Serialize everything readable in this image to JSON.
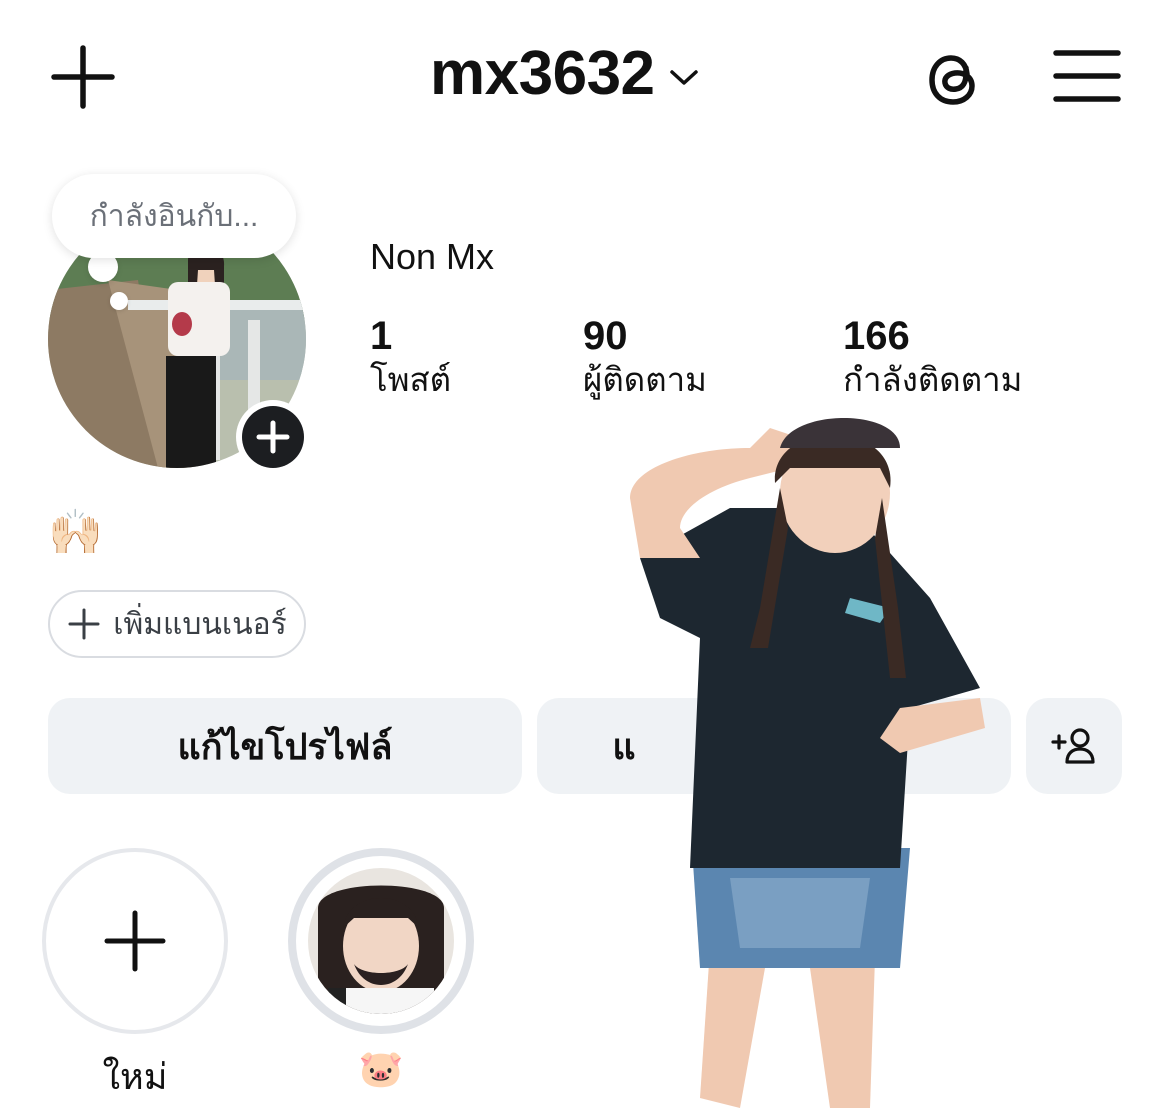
{
  "header": {
    "username": "mx3632"
  },
  "note": {
    "text": "กำลังอินกับ..."
  },
  "profile": {
    "display_name": "Non Mx",
    "bio_emoji": "🙌🏻"
  },
  "stats": [
    {
      "value": "1",
      "label": "โพสต์"
    },
    {
      "value": "90",
      "label": "ผู้ติดตาม"
    },
    {
      "value": "166",
      "label": "กำลังติดตาม"
    }
  ],
  "banner": {
    "label": "เพิ่มแบนเนอร์"
  },
  "buttons": {
    "edit_profile": "แก้ไขโปรไฟล์",
    "share_profile_partial": "แ"
  },
  "highlights": [
    {
      "label": "ใหม่"
    },
    {
      "label": "🐷"
    }
  ],
  "icons": {
    "new_post": "plus-icon",
    "username_dropdown": "chevron-down-icon",
    "threads": "threads-icon",
    "menu": "hamburger-menu-icon",
    "add_story": "plus-circle-icon",
    "banner_add": "plus-icon",
    "discover_people": "add-person-icon"
  }
}
